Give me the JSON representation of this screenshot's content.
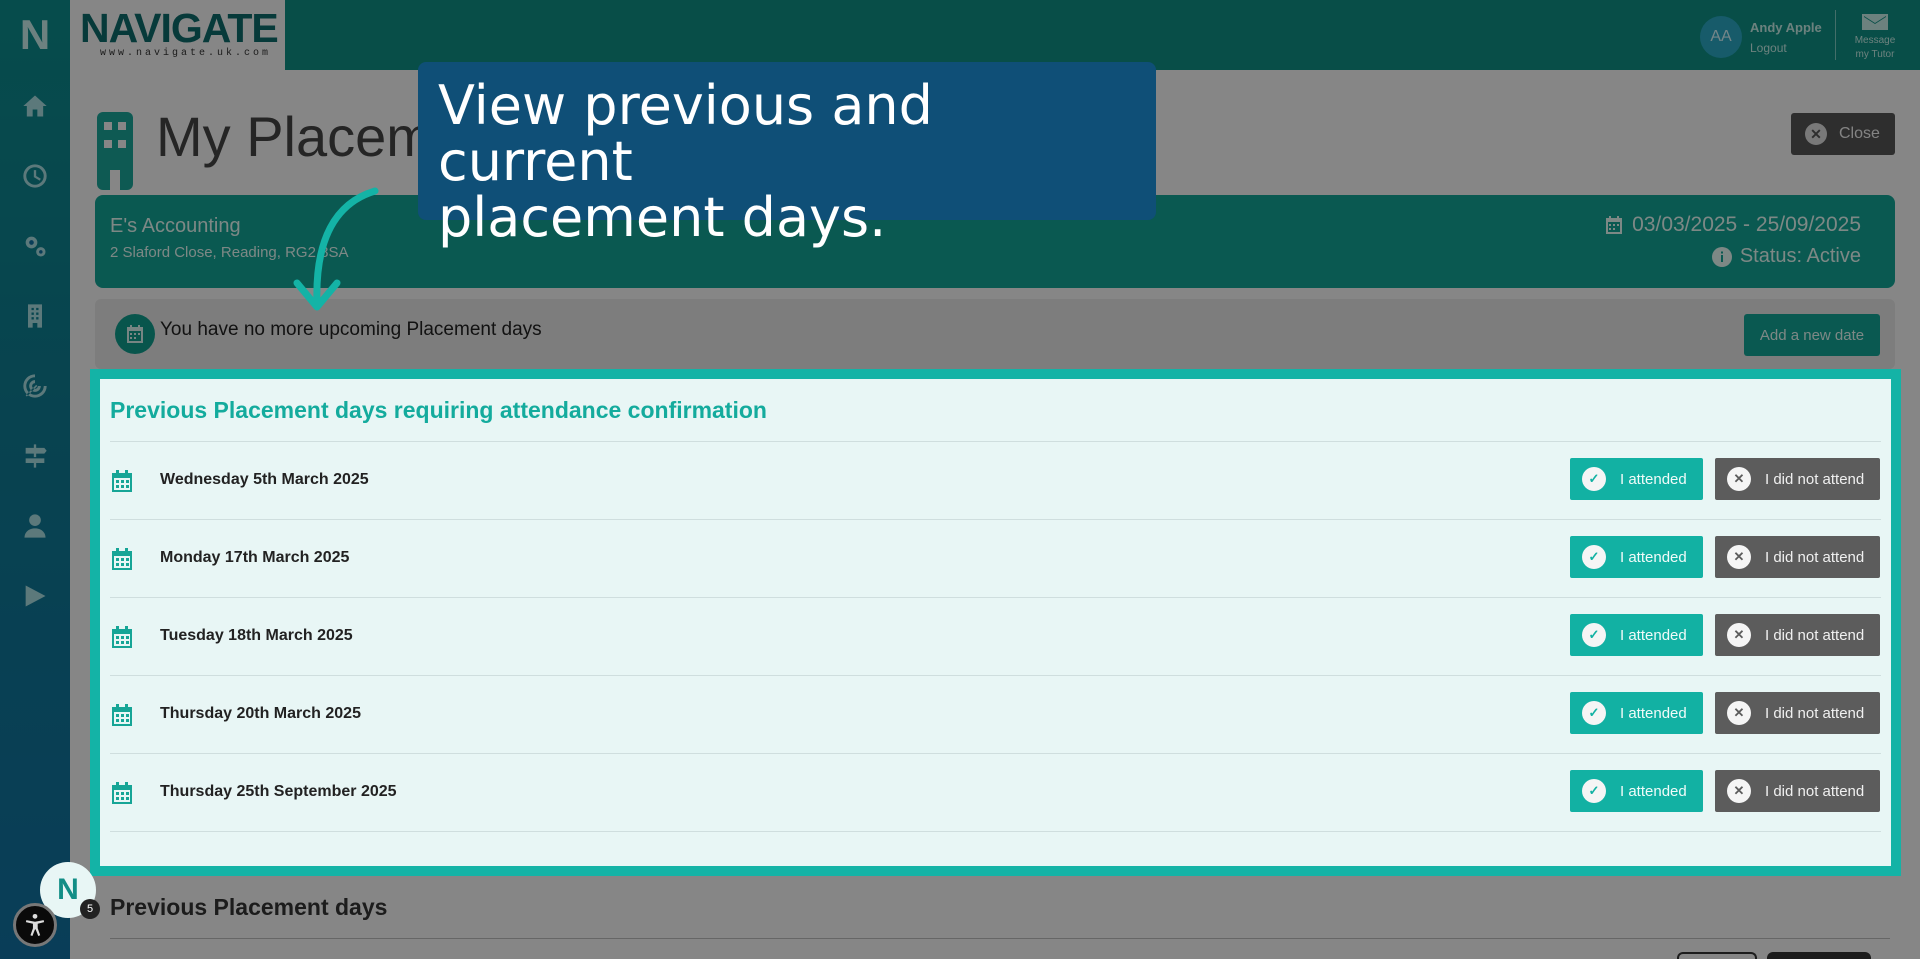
{
  "sidebar": {
    "logo_letter": "N",
    "items": [
      {
        "icon": "home-icon"
      },
      {
        "icon": "clock-icon"
      },
      {
        "icon": "gears-icon"
      },
      {
        "icon": "building-icon"
      },
      {
        "icon": "target-icon"
      },
      {
        "icon": "signpost-icon"
      },
      {
        "icon": "user-icon"
      },
      {
        "icon": "play-icon"
      }
    ]
  },
  "header": {
    "brand_word": "NAVIGATE",
    "brand_sub": "www.navigate.uk.com",
    "user_initials": "AA",
    "user_name": "Andy Apple",
    "logout_label": "Logout",
    "message_line1": "Message",
    "message_line2": "my Tutor"
  },
  "page": {
    "title": "My Placeme",
    "close_label": "Close"
  },
  "placement": {
    "name": "E's Accounting",
    "address": "2 Slaford Close, Reading, RG2 8SA",
    "date_range": "03/03/2025 - 25/09/2025",
    "status": "Status: Active"
  },
  "upcoming": {
    "message": "You have no more upcoming Placement days",
    "add_label": "Add a new date"
  },
  "confirmation": {
    "title": "Previous Placement days requiring attendance confirmation",
    "attended_label": "I attended",
    "not_attended_label": "I did not attend",
    "rows": [
      {
        "date": "Wednesday 5th March 2025"
      },
      {
        "date": "Monday 17th March 2025"
      },
      {
        "date": "Tuesday 18th March 2025"
      },
      {
        "date": "Thursday 20th March 2025"
      },
      {
        "date": "Thursday 25th September 2025"
      }
    ]
  },
  "previous": {
    "title": "Previous Placement days"
  },
  "callout": {
    "line1": "View previous and current",
    "line2": "placement days."
  },
  "bubble": {
    "letter": "N",
    "badge_count": "5"
  },
  "colors": {
    "primary": "#13a294",
    "callout_bg": "#0f4f77",
    "highlight_border": "#14b3a6"
  }
}
